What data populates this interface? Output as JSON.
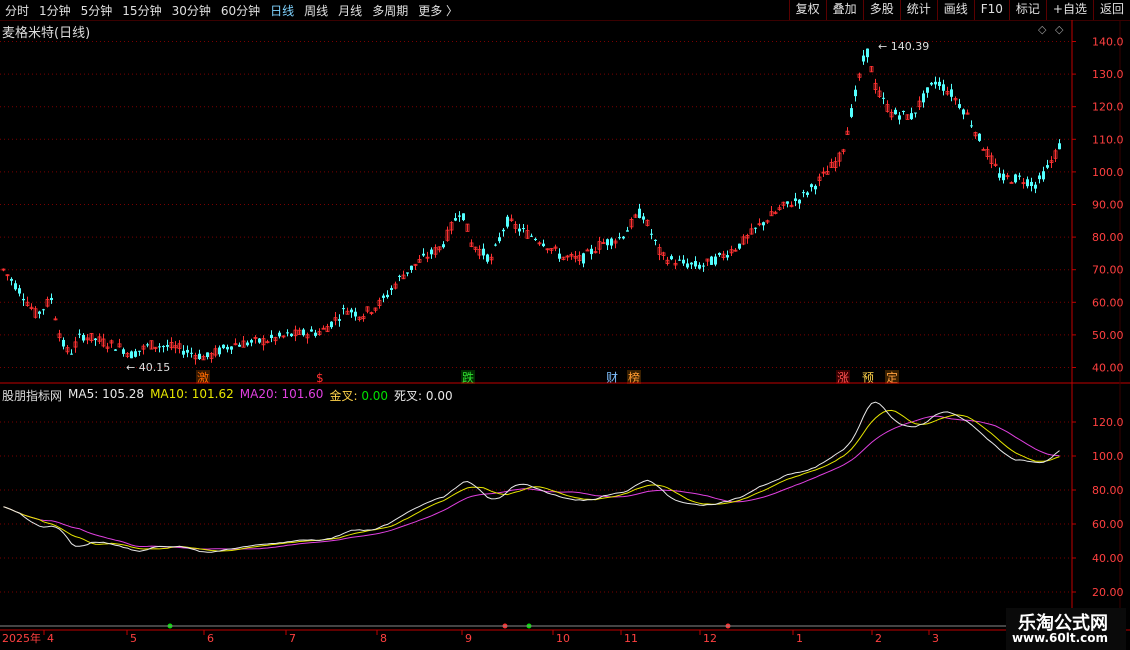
{
  "toolbar": {
    "periods": [
      "分时",
      "1分钟",
      "5分钟",
      "15分钟",
      "30分钟",
      "60分钟",
      "日线",
      "周线",
      "月线",
      "多周期",
      "更多 〉"
    ],
    "active": "日线",
    "right_buttons": [
      "复权",
      "叠加",
      "多股",
      "统计",
      "画线",
      "F10",
      "标记",
      "+自选",
      "返回"
    ]
  },
  "main_chart": {
    "title": "麦格米特(日线)",
    "high_label": "140.39",
    "low_label": "40.15",
    "y_ticks": [
      "140.0",
      "130.0",
      "120.0",
      "110.0",
      "100.0",
      "90.00",
      "80.00",
      "70.00",
      "60.00",
      "50.00",
      "40.00"
    ],
    "event_markers": [
      {
        "text": "激",
        "color": "#ff6a00",
        "bg": "#3a1a00"
      },
      {
        "text": "$",
        "color": "#ff3030",
        "bg": ""
      },
      {
        "text": "跌",
        "color": "#30e030",
        "bg": "#003000"
      },
      {
        "text": "财",
        "color": "#7fc0ff",
        "bg": ""
      },
      {
        "text": "榜",
        "color": "#ff9a30",
        "bg": "#3a2000"
      },
      {
        "text": "涨",
        "color": "#ff5050",
        "bg": "#3a0000"
      },
      {
        "text": "预",
        "color": "#ffd24a",
        "bg": ""
      },
      {
        "text": "定",
        "color": "#ffa040",
        "bg": "#3a2000"
      }
    ]
  },
  "indicator": {
    "name": "股朋指标网",
    "ma5": "MA5: 105.28",
    "ma10": "MA10: 101.62",
    "ma20": "MA20: 101.60",
    "gold_label": "金叉:",
    "gold_value": "0.00",
    "dead": "死叉: 0.00",
    "y_ticks": [
      "120.0",
      "100.0",
      "80.00",
      "60.00",
      "40.00",
      "20.00"
    ]
  },
  "x_axis": {
    "labels": [
      "2025年",
      "4",
      "5",
      "6",
      "7",
      "8",
      "9",
      "10",
      "11",
      "12",
      "1",
      "2",
      "3"
    ]
  },
  "watermark": {
    "line1": "乐淘公式网",
    "line2": "www.60lt.com"
  },
  "colors": {
    "up": "#ff3232",
    "down": "#54ffff",
    "grid": "#7a0000",
    "axis": "#c00000",
    "ma5": "#e8e8e8",
    "ma10": "#e6e600",
    "ma20": "#e040e0"
  }
}
